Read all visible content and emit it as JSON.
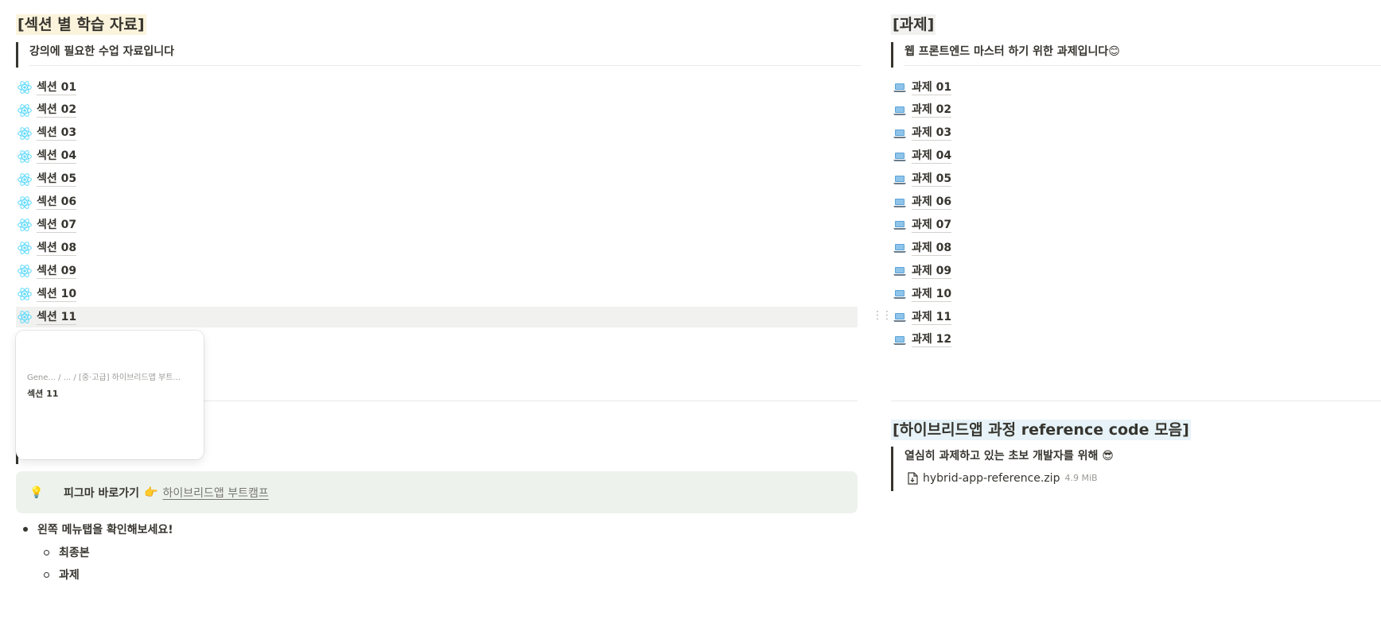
{
  "left": {
    "heading": "[섹션 별 학습 자료]",
    "quote": "강의에 필요한 수업 자료입니다",
    "items": [
      {
        "label": "섹션 01"
      },
      {
        "label": "섹션 02"
      },
      {
        "label": "섹션 03"
      },
      {
        "label": "섹션 04"
      },
      {
        "label": "섹션 05"
      },
      {
        "label": "섹션 06"
      },
      {
        "label": "섹션 07"
      },
      {
        "label": "섹션 08"
      },
      {
        "label": "섹션 09"
      },
      {
        "label": "섹션 10"
      },
      {
        "label": "섹션 11"
      }
    ],
    "item_icon": "react-atom-icon",
    "hovered_index": 10
  },
  "popup": {
    "breadcrumb": "Gene...  / ... / [중·고급] 하이브리드앱 부트...",
    "title": "섹션 11"
  },
  "right": {
    "heading": "[과제]",
    "quote": "웹 프론트엔드 마스터 하기 위한 과제입니다😊",
    "items": [
      {
        "label": "과제 01"
      },
      {
        "label": "과제 02"
      },
      {
        "label": "과제 03"
      },
      {
        "label": "과제 04"
      },
      {
        "label": "과제 05"
      },
      {
        "label": "과제 06"
      },
      {
        "label": "과제 07"
      },
      {
        "label": "과제 08"
      },
      {
        "label": "과제 09"
      },
      {
        "label": "과제 10"
      },
      {
        "label": "과제 11"
      },
      {
        "label": "과제 12"
      }
    ],
    "item_icon": "laptop-icon"
  },
  "callout": {
    "icon": "💡",
    "text": "피그마 바로가기",
    "pointer": "👉",
    "link": "하이브리드앱 부트캠프"
  },
  "bullets": {
    "main": "왼쪽 메뉴탭을 확인해보세요!",
    "sub": [
      "최종본",
      "과제"
    ]
  },
  "reference": {
    "heading": "[하이브리드앱 과정 reference code 모음]",
    "quote": "열심히 과제하고 있는 초보 개발자를 위해 😎",
    "file_name": "hybrid-app-reference.zip",
    "file_size": "4.9 MiB"
  },
  "colors": {
    "text": "#37352f",
    "yellow_highlight": "#fbf3db",
    "gray_highlight": "#f1f1ef",
    "blue_highlight": "#e7f3f8",
    "callout_bg": "#edf3ec",
    "react_cyan": "#61dafb",
    "laptop_blue": "#5aa3d8"
  }
}
